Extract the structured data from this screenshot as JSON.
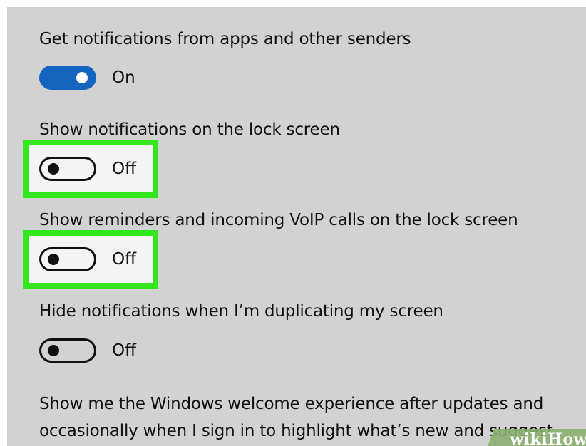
{
  "settings": {
    "items": [
      {
        "label": "Get notifications from apps and other senders",
        "state": "On"
      },
      {
        "label": "Show notifications on the lock screen",
        "state": "Off"
      },
      {
        "label": "Show reminders and incoming VoIP calls on the lock screen",
        "state": "Off"
      },
      {
        "label": "Hide notifications when I’m duplicating my screen",
        "state": "Off"
      }
    ],
    "welcome_text_line1": "Show me the Windows welcome experience after updates and",
    "welcome_text_line2": "occasionally when I sign in to highlight what’s new and suggest"
  },
  "watermark": "wikiHow",
  "colors": {
    "background": "#d2d2d2",
    "toggle_on": "#1565c0",
    "highlight": "#33e61e"
  }
}
